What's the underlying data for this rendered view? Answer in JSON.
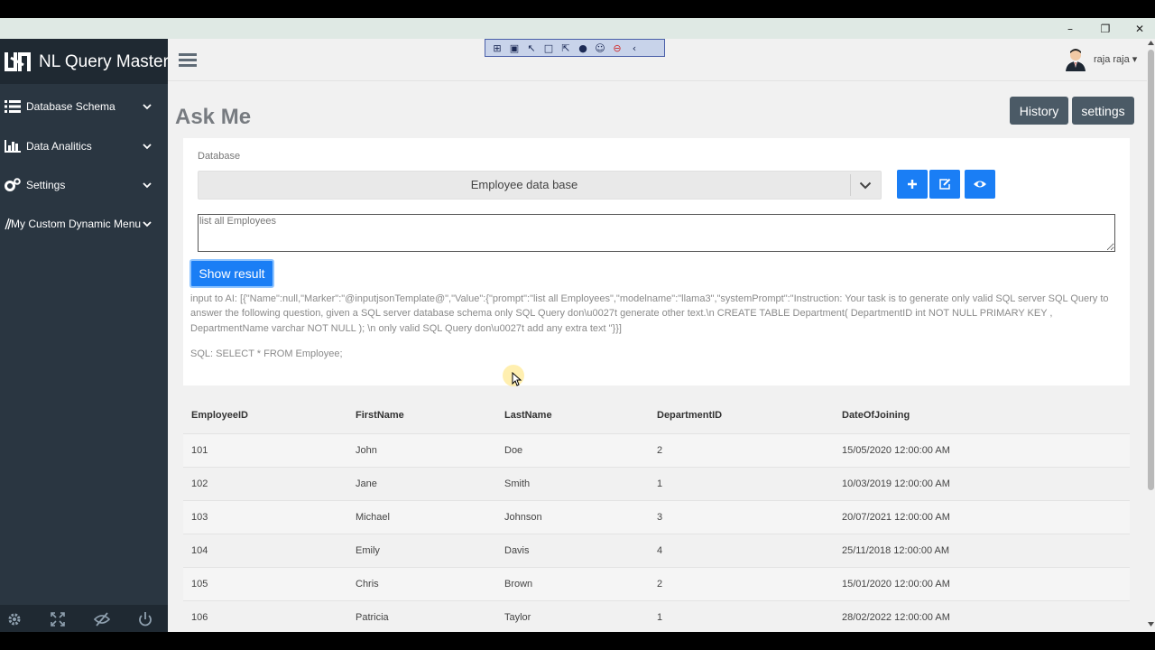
{
  "app": {
    "title": "NL Query Master",
    "user_name": "raja raja"
  },
  "window_controls": {
    "minimize": "–",
    "maximize": "❐",
    "close": "✕"
  },
  "sidebar": {
    "items": [
      {
        "label": "Database Schema",
        "icon": "list-icon"
      },
      {
        "label": "Data Analitics",
        "icon": "bar-chart-icon"
      },
      {
        "label": "Settings",
        "icon": "cogs-icon"
      },
      {
        "label": "My Custom Dynamic Menu",
        "icon": "edit-icon"
      }
    ],
    "footer_icons": [
      "gear-icon",
      "fullscreen-icon",
      "eye-slash-icon",
      "power-icon"
    ]
  },
  "recorder_toolbar": {
    "icons": [
      "⊞",
      "▣",
      "↖",
      "□",
      "⇱",
      "●",
      "☺",
      "⊖",
      "‹"
    ]
  },
  "page": {
    "title": "Ask Me",
    "history_button": "History",
    "settings_button": "settings"
  },
  "form": {
    "database_label": "Database",
    "database_selected": "Employee data base",
    "prompt_value": "list all Employees",
    "show_button": "Show result",
    "ai_input": "input to AI: [{\"Name\":null,\"Marker\":\"@inputjsonTemplate@\",\"Value\":{\"prompt\":\"list all Employees\",\"modelname\":\"llama3\",\"systemPrompt\":\"Instruction: Your task is to generate only valid SQL server SQL Query to answer the following question, given a SQL server database schema only SQL Query don\\u0027t generate other text.\\n CREATE TABLE Department( DepartmentID int NOT NULL PRIMARY KEY , DepartmentName varchar NOT NULL ); \\n only valid SQL Query don\\u0027t add any extra text \"}}]",
    "sql_result": "SQL: SELECT * FROM Employee;"
  },
  "colors": {
    "sidebar_bg": "#2a3641",
    "primary_blue": "#1a7ef5",
    "dark_button": "#4b5a66"
  },
  "table": {
    "columns": [
      "EmployeeID",
      "FirstName",
      "LastName",
      "DepartmentID",
      "DateOfJoining"
    ],
    "rows": [
      [
        "101",
        "John",
        "Doe",
        "2",
        "15/05/2020 12:00:00 AM"
      ],
      [
        "102",
        "Jane",
        "Smith",
        "1",
        "10/03/2019 12:00:00 AM"
      ],
      [
        "103",
        "Michael",
        "Johnson",
        "3",
        "20/07/2021 12:00:00 AM"
      ],
      [
        "104",
        "Emily",
        "Davis",
        "4",
        "25/11/2018 12:00:00 AM"
      ],
      [
        "105",
        "Chris",
        "Brown",
        "2",
        "15/01/2020 12:00:00 AM"
      ],
      [
        "106",
        "Patricia",
        "Taylor",
        "1",
        "28/02/2022 12:00:00 AM"
      ]
    ]
  }
}
